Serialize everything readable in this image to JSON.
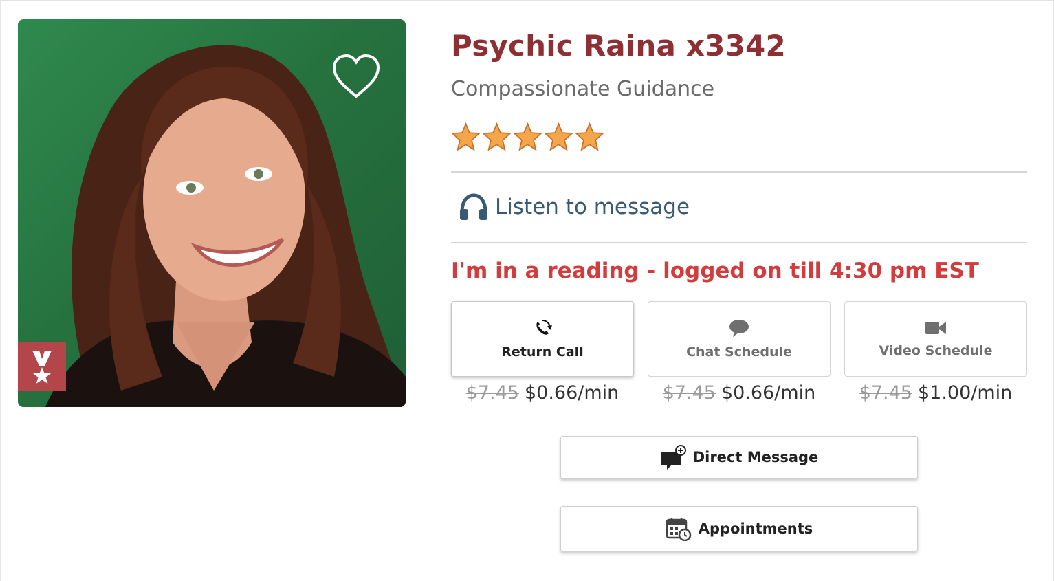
{
  "advisor": {
    "name": "Psychic Raina x3342",
    "tagline": "Compassionate Guidance",
    "rating_stars": 5
  },
  "listen": {
    "label": "Listen to message"
  },
  "status": {
    "text": "I'm in a reading - logged on till 4:30 pm EST"
  },
  "services": [
    {
      "label": "Return Call",
      "icon": "phone-icon",
      "old_price": "$7.45",
      "price": "$0.66/min"
    },
    {
      "label": "Chat Schedule",
      "icon": "chat-bubble-icon",
      "old_price": "$7.45",
      "price": "$0.66/min"
    },
    {
      "label": "Video Schedule",
      "icon": "video-camera-icon",
      "old_price": "$7.45",
      "price": "$1.00/min"
    }
  ],
  "actions": {
    "direct_message": "Direct Message",
    "appointments": "Appointments"
  },
  "colors": {
    "name": "#8e2f33",
    "status": "#d23c3c",
    "badge": "#b4454a",
    "star": "#f5a54a",
    "link": "#3a5a74"
  }
}
